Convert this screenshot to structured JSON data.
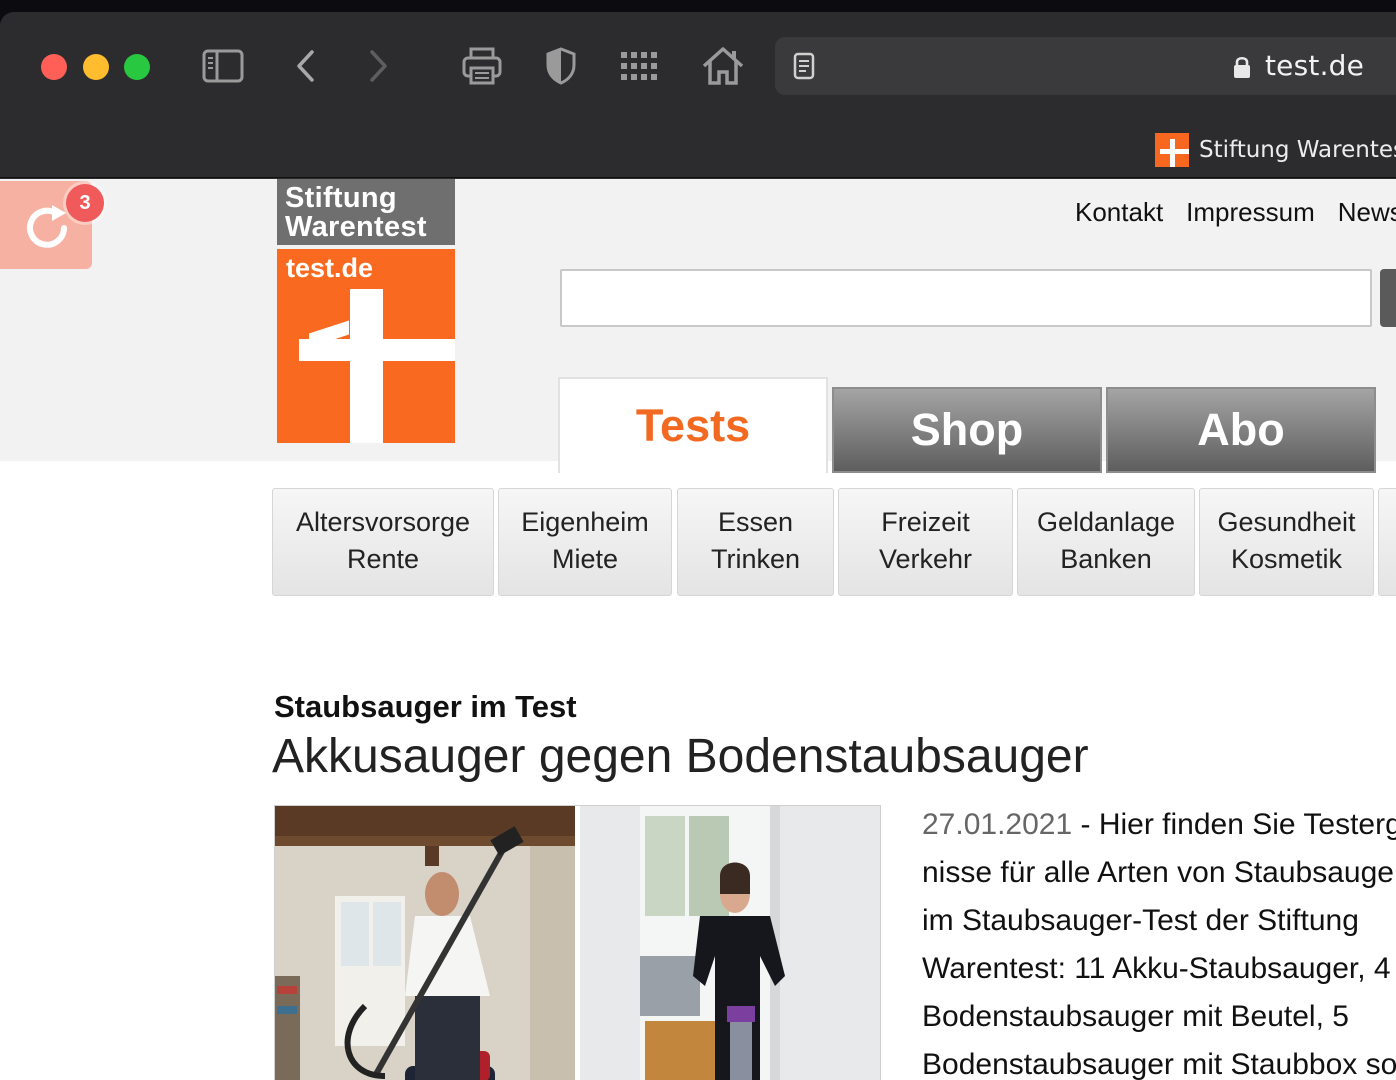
{
  "browser": {
    "url_host": "test.de",
    "tab_title": "Stiftung Warentest"
  },
  "extension": {
    "badge_count": "3"
  },
  "logo": {
    "line1": "Stiftung",
    "line2": "Warentest",
    "domain": "test.de"
  },
  "topnav": [
    "Kontakt",
    "Impressum",
    "Newsletter"
  ],
  "search": {
    "value": "",
    "placeholder": ""
  },
  "main_tabs": [
    "Tests",
    "Shop",
    "Abo"
  ],
  "categories": [
    {
      "line1": "Altersvorsorge",
      "line2": "Rente"
    },
    {
      "line1": "Eigenheim",
      "line2": "Miete"
    },
    {
      "line1": "Essen",
      "line2": "Trinken"
    },
    {
      "line1": "Freizeit",
      "line2": "Verkehr"
    },
    {
      "line1": "Geldanlage",
      "line2": "Banken"
    },
    {
      "line1": "Gesundheit",
      "line2": "Kosmetik"
    }
  ],
  "article": {
    "kicker": "Staubsauger im Test",
    "headline": "Akkusauger gegen Bodenstaubsauger",
    "date": "27.01.2021",
    "teaser_lines": [
      " - Hier finden Sie Testergeb-",
      "nisse für alle Arten von Staubsaugern",
      "im Staubsauger-Test der Stiftung",
      "Warentest: 11 Akku-Staubsauger, 4",
      "Bodenstaubsauger mit Beutel, 5",
      "Bodenstaubsauger mit Staubbox sowie"
    ]
  },
  "colors": {
    "brand_orange": "#f26a21",
    "chrome_dark": "#2c2c2e"
  }
}
